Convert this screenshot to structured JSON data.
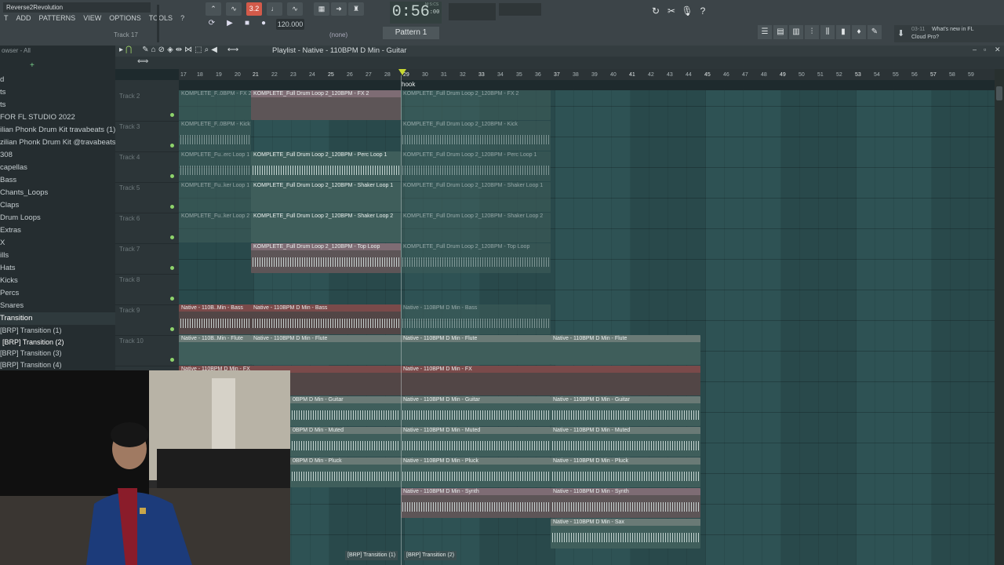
{
  "app": {
    "project_title": "Reverse2Revolution"
  },
  "menu": [
    "T",
    "ADD",
    "PATTERNS",
    "VIEW",
    "OPTIONS",
    "TOOLS",
    "?"
  ],
  "track_hint": "Track 17",
  "toolbar": {
    "mode_label": "3.2",
    "tempo": "120.000",
    "time": "0:56",
    "time_frac": ":00",
    "time_unit": "M:S:CS",
    "pattern_none": "(none)",
    "pattern": "Pattern 1"
  },
  "news": {
    "date": "03-11",
    "title": "What's new in FL",
    "subtitle": "Cloud Pro?"
  },
  "browser": {
    "header": "owser - All",
    "items": [
      "d",
      "ts",
      "ts",
      "FOR FL STUDIO 2022",
      "ilian Phonk Drum Kit travabeats (1)",
      "zilian Phonk Drum Kit @travabeats",
      "308",
      "capellas",
      "Bass",
      "Chants_Loops",
      "Claps",
      "Drum Loops",
      "Extras",
      "X",
      "ills",
      "Hats",
      "Kicks",
      "Percs",
      "Snares",
      "Transition"
    ],
    "sub_items": [
      "[BRP] Transition (1)",
      "[BRP] Transition (2)",
      "[BRP] Transition (3)",
      "[BRP] Transition (4)"
    ]
  },
  "playlist": {
    "title": "Playlist - Native - 110BPM D Min - Guitar",
    "hook_marker": "hook",
    "ruler": [
      "17",
      "18",
      "19",
      "20",
      "21",
      "22",
      "23",
      "24",
      "25",
      "26",
      "27",
      "28",
      "29",
      "30",
      "31",
      "32",
      "33",
      "34",
      "35",
      "36",
      "37",
      "38",
      "39",
      "40",
      "41",
      "42",
      "43",
      "44",
      "45",
      "46",
      "47",
      "48",
      "49",
      "50",
      "51",
      "52",
      "53",
      "54",
      "55",
      "56",
      "57",
      "58",
      "59"
    ],
    "tracks": [
      "Track 2",
      "Track 3",
      "Track 4",
      "Track 5",
      "Track 6",
      "Track 7",
      "Track 8",
      "Track 9",
      "Track 10"
    ],
    "clips": {
      "c1a": "KOMPLETE_F..0BPM - FX 2",
      "c1b": "KOMPLETE_Full Drum Loop 2_120BPM - FX 2",
      "c1c": "KOMPLETE_Full Drum Loop 2_120BPM - FX 2",
      "c2a": "KOMPLETE_F..0BPM - Kick",
      "c2b": "KOMPLETE_Full Drum Loop 2_120BPM - Kick",
      "c3a": "KOMPLETE_Fu..erc Loop 1",
      "c3b": "KOMPLETE_Full Drum Loop 2_120BPM - Perc Loop 1",
      "c3c": "KOMPLETE_Full Drum Loop 2_120BPM - Perc Loop 1",
      "c4a": "KOMPLETE_Fu..ker Loop 1",
      "c4b": "KOMPLETE_Full Drum Loop 2_120BPM - Shaker Loop 1",
      "c4c": "KOMPLETE_Full Drum Loop 2_120BPM - Shaker Loop 1",
      "c5a": "KOMPLETE_Fu..ker Loop 2",
      "c5b": "KOMPLETE_Full Drum Loop 2_120BPM - Shaker Loop 2",
      "c5c": "KOMPLETE_Full Drum Loop 2_120BPM - Shaker Loop 2",
      "c6b": "KOMPLETE_Full Drum Loop 2_120BPM - Top Loop",
      "c6c": "KOMPLETE_Full Drum Loop 2_120BPM - Top Loop",
      "c8a": "Native - 110B..Min - Bass",
      "c8b": "Native - 110BPM D Min - Bass",
      "c8c": "Native - 110BPM D Min - Bass",
      "c9a": "Native - 110B..Min - Flute",
      "c9b": "Native - 110BPM D Min - Flute",
      "c9c": "Native - 110BPM D Min - Flute",
      "c9d": "Native - 110BPM D Min - Flute",
      "c10a": "Native - 110BPM D Min - FX",
      "c10b": "Native - 110BPM D Min - FX",
      "c11a": "0BPM D Min - Guitar",
      "c11b": "Native - 110BPM D Min - Guitar",
      "c11c": "Native - 110BPM D Min - Guitar",
      "c12a": "0BPM D Min - Muted",
      "c12b": "Native - 110BPM D Min - Muted",
      "c12c": "Native - 110BPM D Min - Muted",
      "c13a": "0BPM D Min - Pluck",
      "c13b": "Native - 110BPM D Min - Pluck",
      "c13c": "Native - 110BPM D Min - Pluck",
      "c14b": "Native - 110BPM D Min - Synth",
      "c14c": "Native - 110BPM D Min - Synth",
      "c15c": "Native - 110BPM D Min - Sax",
      "t1": "[BRP] Transition (1)",
      "t2": "[BRP] Transition (2)"
    }
  },
  "colors": {
    "accent": "#d35a4a",
    "grid_dark": "#29494b",
    "grid_light": "#2e5254",
    "track_led": "#8ed36b"
  }
}
